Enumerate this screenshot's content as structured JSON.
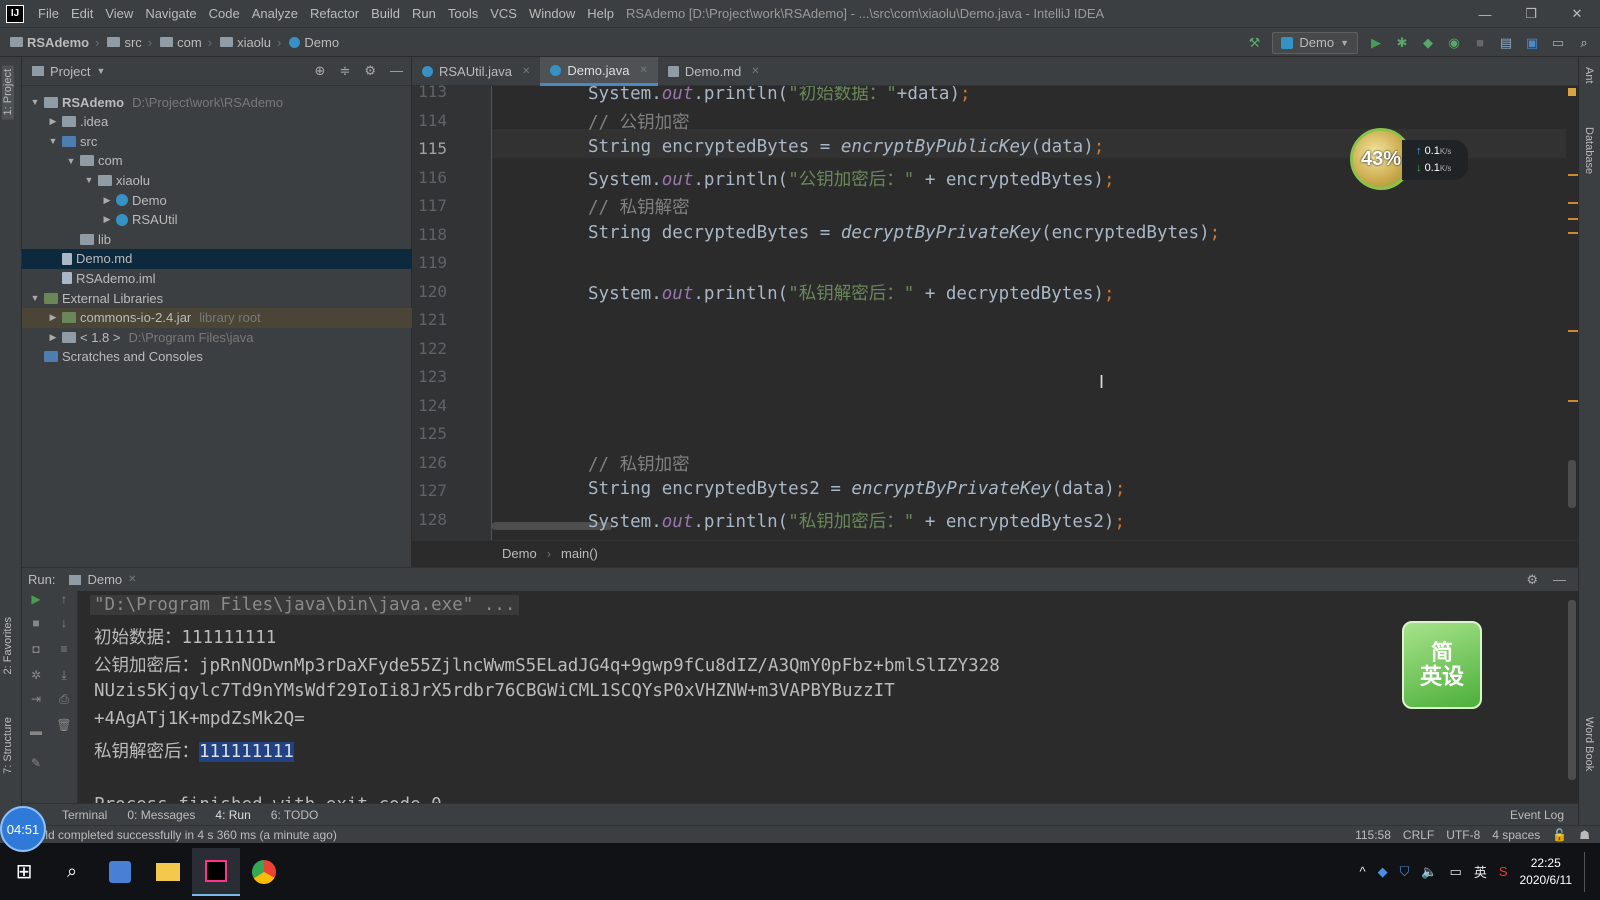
{
  "window": {
    "title": "RSAdemo [D:\\Project\\work\\RSAdemo] - ...\\src\\com\\xiaolu\\Demo.java - IntelliJ IDEA",
    "menu": [
      "File",
      "Edit",
      "View",
      "Navigate",
      "Code",
      "Analyze",
      "Refactor",
      "Build",
      "Run",
      "Tools",
      "VCS",
      "Window",
      "Help"
    ]
  },
  "navbar": {
    "crumbs": [
      "RSAdemo",
      "src",
      "com",
      "xiaolu",
      "Demo"
    ],
    "run_config": "Demo"
  },
  "project": {
    "title": "Project",
    "tree": [
      {
        "label": "RSAdemo",
        "hint": "D:\\Project\\work\\RSAdemo",
        "depth": 0,
        "arrow": "▼",
        "icon": "folder"
      },
      {
        "label": ".idea",
        "hint": "",
        "depth": 1,
        "arrow": "▶",
        "icon": "folder"
      },
      {
        "label": "src",
        "hint": "",
        "depth": 1,
        "arrow": "▼",
        "icon": "src"
      },
      {
        "label": "com",
        "hint": "",
        "depth": 2,
        "arrow": "▼",
        "icon": "folder"
      },
      {
        "label": "xiaolu",
        "hint": "",
        "depth": 3,
        "arrow": "▼",
        "icon": "folder"
      },
      {
        "label": "Demo",
        "hint": "",
        "depth": 4,
        "arrow": "▶",
        "icon": "cls"
      },
      {
        "label": "RSAUtil",
        "hint": "",
        "depth": 4,
        "arrow": "▶",
        "icon": "cls"
      },
      {
        "label": "lib",
        "hint": "",
        "depth": 2,
        "arrow": "",
        "icon": "folder"
      },
      {
        "label": "Demo.md",
        "hint": "",
        "depth": 1,
        "arrow": "",
        "icon": "file",
        "selected": true
      },
      {
        "label": "RSAdemo.iml",
        "hint": "",
        "depth": 1,
        "arrow": "",
        "icon": "file"
      },
      {
        "label": "External Libraries",
        "hint": "",
        "depth": 0,
        "arrow": "▼",
        "icon": "lib"
      },
      {
        "label": "commons-io-2.4.jar",
        "hint": "library root",
        "depth": 1,
        "arrow": "▶",
        "icon": "lib",
        "highlight": true
      },
      {
        "label": "< 1.8 >",
        "hint": "D:\\Program Files\\java",
        "depth": 1,
        "arrow": "▶",
        "icon": "folder"
      },
      {
        "label": "Scratches and Consoles",
        "hint": "",
        "depth": 0,
        "arrow": "",
        "icon": "src"
      }
    ]
  },
  "editor_tabs": [
    {
      "label": "RSAUtil.java",
      "active": false
    },
    {
      "label": "Demo.java",
      "active": true
    },
    {
      "label": "Demo.md",
      "active": false
    }
  ],
  "code": {
    "current_line": 115,
    "lines": [
      {
        "n": 113,
        "parts": [
          [
            "System.",
            "p"
          ],
          [
            "out",
            "f"
          ],
          [
            ".println(",
            "p"
          ],
          [
            "\"初始数据：\"",
            "s"
          ],
          [
            "+data)",
            "p"
          ],
          [
            ";",
            "k"
          ]
        ]
      },
      {
        "n": 114,
        "parts": [
          [
            "// 公钥加密",
            "c"
          ]
        ]
      },
      {
        "n": 115,
        "parts": [
          [
            "String encryptedBytes = ",
            "p"
          ],
          [
            "encryptByPublicKey",
            "i"
          ],
          [
            "(data)",
            "p"
          ],
          [
            ";",
            "k"
          ]
        ]
      },
      {
        "n": 116,
        "parts": [
          [
            "System.",
            "p"
          ],
          [
            "out",
            "f"
          ],
          [
            ".println(",
            "p"
          ],
          [
            "\"公钥加密后：\"",
            "s"
          ],
          [
            " + encryptedBytes)",
            "p"
          ],
          [
            ";",
            "k"
          ]
        ]
      },
      {
        "n": 117,
        "parts": [
          [
            "// 私钥解密",
            "c"
          ]
        ]
      },
      {
        "n": 118,
        "parts": [
          [
            "String decryptedBytes = ",
            "p"
          ],
          [
            "decryptByPrivateKey",
            "i"
          ],
          [
            "(encryptedBytes)",
            "p"
          ],
          [
            ";",
            "k"
          ]
        ]
      },
      {
        "n": 119,
        "parts": []
      },
      {
        "n": 120,
        "parts": [
          [
            "System.",
            "p"
          ],
          [
            "out",
            "f"
          ],
          [
            ".println(",
            "p"
          ],
          [
            "\"私钥解密后：\"",
            "s"
          ],
          [
            " + decryptedBytes)",
            "p"
          ],
          [
            ";",
            "k"
          ]
        ]
      },
      {
        "n": 121,
        "parts": []
      },
      {
        "n": 122,
        "parts": []
      },
      {
        "n": 123,
        "parts": []
      },
      {
        "n": 124,
        "parts": []
      },
      {
        "n": 125,
        "parts": []
      },
      {
        "n": 126,
        "parts": [
          [
            "// 私钥加密",
            "c"
          ]
        ]
      },
      {
        "n": 127,
        "parts": [
          [
            "String encryptedBytes2 = ",
            "p"
          ],
          [
            "encryptByPrivateKey",
            "i"
          ],
          [
            "(data)",
            "p"
          ],
          [
            ";",
            "k"
          ]
        ]
      },
      {
        "n": 128,
        "parts": [
          [
            "System.",
            "p"
          ],
          [
            "out",
            "f"
          ],
          [
            ".println(",
            "p"
          ],
          [
            "\"私钥加密后：\"",
            "s"
          ],
          [
            " + encryptedBytes2)",
            "p"
          ],
          [
            ";",
            "k"
          ]
        ]
      }
    ]
  },
  "editor_breadcrumb": [
    "Demo",
    "main()"
  ],
  "run": {
    "label": "Run:",
    "tab": "Demo",
    "console": [
      {
        "text": "\"D:\\Program Files\\java\\bin\\java.exe\" ...",
        "type": "cmd"
      },
      {
        "text": "初始数据：111111111",
        "type": "out"
      },
      {
        "text": "公钥加密后：jpRnNODwnMp3rDaXFyde55ZjlncWwmS5ELadJG4q+9gwp9fCu8dIZ/A3QmY0pFbz+bmlSlIZY328",
        "type": "out"
      },
      {
        "text": "NUzis5Kjqylc7Td9nYMsWdf29IoIi8JrX5rdbr76CBGWiCML1SCQYsP0xVHZNW+m3VAPBYBuzzIT",
        "type": "out"
      },
      {
        "text": "+4AgATj1K+mpdZsMk2Q=",
        "type": "out"
      },
      {
        "text": "私钥解密后：",
        "type": "out",
        "selected": "111111111"
      },
      {
        "text": "",
        "type": "out"
      },
      {
        "text": "Process finished with exit code 0",
        "type": "out"
      }
    ]
  },
  "bottom_tabs": [
    "Terminal",
    "0: Messages",
    "4: Run",
    "6: TODO"
  ],
  "event_log": "Event Log",
  "status": {
    "message": "Build completed successfully in 4 s 360 ms (a minute ago)",
    "position": "115:58",
    "line_sep": "CRLF",
    "encoding": "UTF-8",
    "indent": "4 spaces"
  },
  "side_tabs": {
    "left": [
      "1: Project",
      "2: Favorites",
      "7: Structure"
    ],
    "right": [
      "Ant",
      "Database",
      "Word Book"
    ]
  },
  "widgets": {
    "net_percent": "43%",
    "net_up": "0.1",
    "net_down": "0.1",
    "net_unit": "K/s",
    "dict_text": "简\n英设",
    "record_time": "04:51"
  },
  "taskbar": {
    "time": "22:25",
    "date": "2020/6/11",
    "ime": "英"
  }
}
